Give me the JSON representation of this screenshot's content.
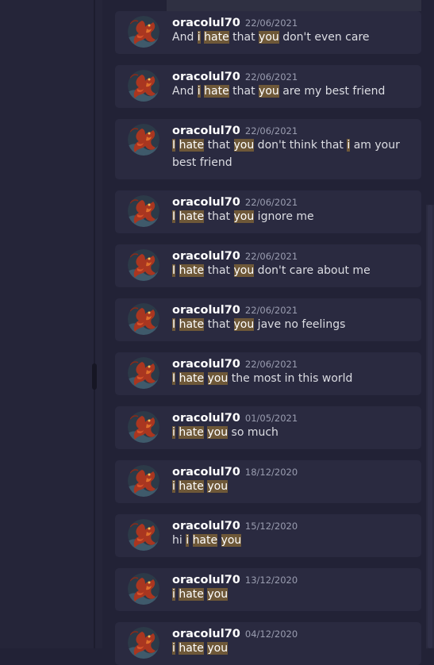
{
  "messages": [
    {
      "author": "oracolul70",
      "date": "22/06/2021",
      "parts": [
        {
          "t": "And "
        },
        {
          "t": "i",
          "hl": true
        },
        {
          "t": " "
        },
        {
          "t": "hate",
          "hl": true
        },
        {
          "t": " that "
        },
        {
          "t": "you",
          "hl": true
        },
        {
          "t": " don't even care"
        }
      ]
    },
    {
      "author": "oracolul70",
      "date": "22/06/2021",
      "parts": [
        {
          "t": "And "
        },
        {
          "t": "i",
          "hl": true
        },
        {
          "t": " "
        },
        {
          "t": "hate",
          "hl": true
        },
        {
          "t": " that "
        },
        {
          "t": "you",
          "hl": true
        },
        {
          "t": " are my best friend"
        }
      ]
    },
    {
      "author": "oracolul70",
      "date": "22/06/2021",
      "parts": [
        {
          "t": "I",
          "hl": true
        },
        {
          "t": " "
        },
        {
          "t": "hate",
          "hl": true
        },
        {
          "t": " that "
        },
        {
          "t": "you",
          "hl": true
        },
        {
          "t": " don't think that "
        },
        {
          "t": "i",
          "hl": true
        },
        {
          "t": " am your best friend"
        }
      ]
    },
    {
      "author": "oracolul70",
      "date": "22/06/2021",
      "parts": [
        {
          "t": "I",
          "hl": true
        },
        {
          "t": " "
        },
        {
          "t": "hate",
          "hl": true
        },
        {
          "t": " that "
        },
        {
          "t": "you",
          "hl": true
        },
        {
          "t": " ignore me"
        }
      ]
    },
    {
      "author": "oracolul70",
      "date": "22/06/2021",
      "parts": [
        {
          "t": "I",
          "hl": true
        },
        {
          "t": " "
        },
        {
          "t": "hate",
          "hl": true
        },
        {
          "t": " that "
        },
        {
          "t": "you",
          "hl": true
        },
        {
          "t": " don't care about me"
        }
      ]
    },
    {
      "author": "oracolul70",
      "date": "22/06/2021",
      "parts": [
        {
          "t": "I",
          "hl": true
        },
        {
          "t": " "
        },
        {
          "t": "hate",
          "hl": true
        },
        {
          "t": " that "
        },
        {
          "t": "you",
          "hl": true
        },
        {
          "t": " jave no feelings"
        }
      ]
    },
    {
      "author": "oracolul70",
      "date": "22/06/2021",
      "parts": [
        {
          "t": "I",
          "hl": true
        },
        {
          "t": " "
        },
        {
          "t": "hate",
          "hl": true
        },
        {
          "t": " "
        },
        {
          "t": "you",
          "hl": true
        },
        {
          "t": " the most in this world"
        }
      ]
    },
    {
      "author": "oracolul70",
      "date": "01/05/2021",
      "parts": [
        {
          "t": "i",
          "hl": true
        },
        {
          "t": " "
        },
        {
          "t": "hate",
          "hl": true
        },
        {
          "t": " "
        },
        {
          "t": "you",
          "hl": true
        },
        {
          "t": " so much"
        }
      ]
    },
    {
      "author": "oracolul70",
      "date": "18/12/2020",
      "parts": [
        {
          "t": "i",
          "hl": true
        },
        {
          "t": " "
        },
        {
          "t": "hate",
          "hl": true
        },
        {
          "t": " "
        },
        {
          "t": "you",
          "hl": true
        }
      ]
    },
    {
      "author": "oracolul70",
      "date": "15/12/2020",
      "parts": [
        {
          "t": "hi "
        },
        {
          "t": "i",
          "hl": true
        },
        {
          "t": " "
        },
        {
          "t": "hate",
          "hl": true
        },
        {
          "t": " "
        },
        {
          "t": "you",
          "hl": true
        }
      ]
    },
    {
      "author": "oracolul70",
      "date": "13/12/2020",
      "parts": [
        {
          "t": "i",
          "hl": true
        },
        {
          "t": " "
        },
        {
          "t": "hate",
          "hl": true
        },
        {
          "t": " "
        },
        {
          "t": "you",
          "hl": true
        }
      ]
    },
    {
      "author": "oracolul70",
      "date": "04/12/2020",
      "parts": [
        {
          "t": "i",
          "hl": true
        },
        {
          "t": " "
        },
        {
          "t": "hate",
          "hl": true
        },
        {
          "t": " "
        },
        {
          "t": "you",
          "hl": true
        }
      ]
    }
  ],
  "avatar_icon": "dragon-avatar-icon",
  "colors": {
    "highlight": "#6e5838",
    "card": "#2a2a40",
    "background": "#222236"
  }
}
